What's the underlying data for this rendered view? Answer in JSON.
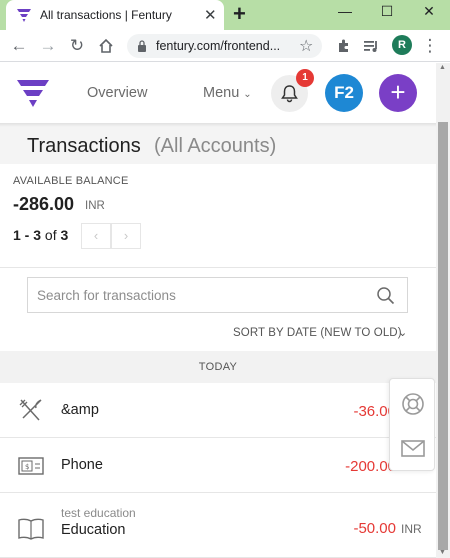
{
  "browser": {
    "tab_title": "All transactions | Fentury",
    "url": "fentury.com/frontend...",
    "profile_initial": "R",
    "window_controls": {
      "minimize": "—",
      "maximize": "☐",
      "close": "✕"
    },
    "new_tab": "+"
  },
  "header": {
    "nav_overview": "Overview",
    "nav_menu": "Menu",
    "notification_count": "1",
    "workspace_badge": "F2",
    "add_label": "+"
  },
  "page": {
    "title": "Transactions",
    "subtitle": "(All Accounts)"
  },
  "balance": {
    "label": "AVAILABLE BALANCE",
    "value": "-286.00",
    "currency": "INR"
  },
  "pager": {
    "range": "1 - 3",
    "of": " of ",
    "total": "3",
    "prev": "‹",
    "next": "›"
  },
  "search": {
    "placeholder": "Search for transactions"
  },
  "sort": {
    "label": "SORT BY DATE (NEW TO OLD)"
  },
  "group_label": "TODAY",
  "transactions": [
    {
      "name": "&amp",
      "subtitle": "",
      "amount": "-36.00",
      "currency": "",
      "icon": "fork-knife-icon"
    },
    {
      "name": "Phone",
      "subtitle": "",
      "amount": "-200.00",
      "currency": "",
      "icon": "bill-icon"
    },
    {
      "name": "Education",
      "subtitle": "test education",
      "amount": "-50.00",
      "currency": "INR",
      "icon": "book-icon"
    }
  ],
  "colors": {
    "brand_purple": "#7a3fc6",
    "accent_blue": "#1e88d4",
    "negative": "#e53935",
    "tabbar_green": "#b7dea6"
  }
}
